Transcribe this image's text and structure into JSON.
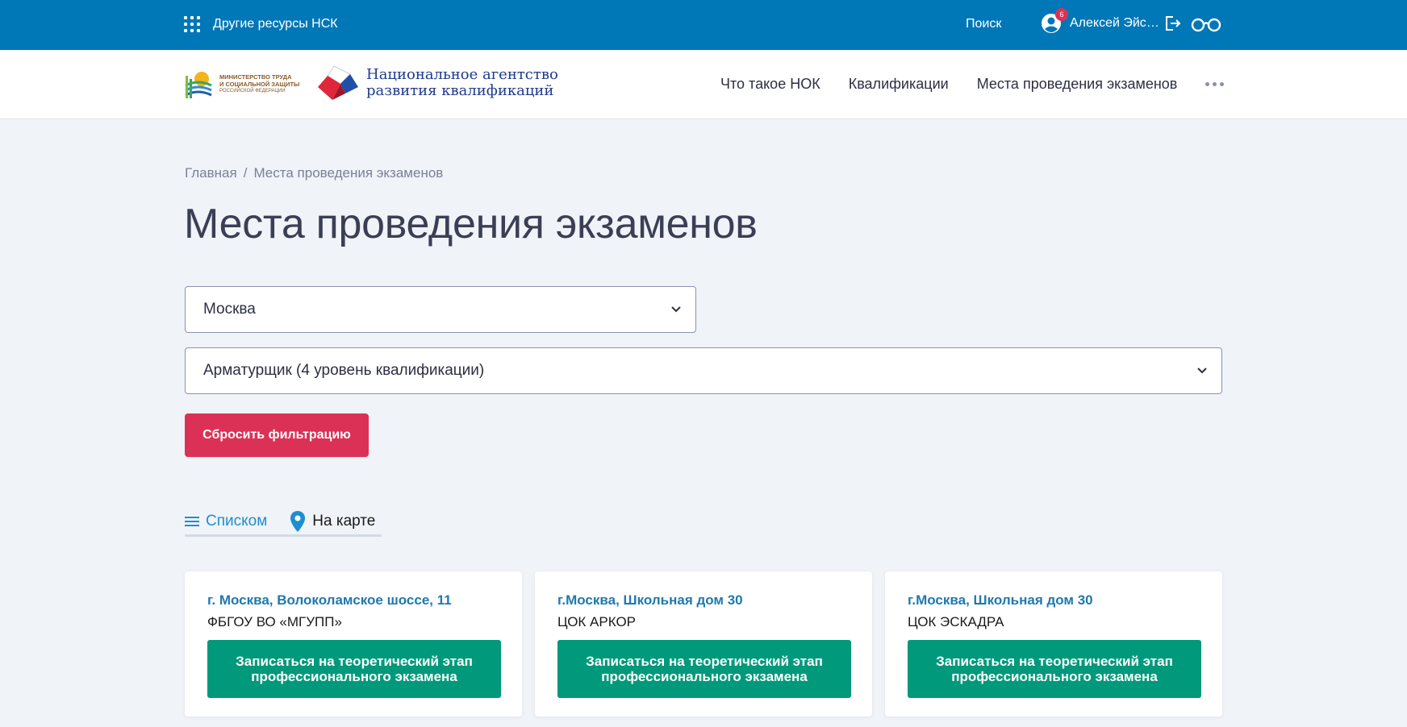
{
  "topbar": {
    "resources_label": "Другие ресурсы НСК",
    "search_label": "Поиск",
    "user_name": "Алексей Эйсмонт",
    "notifications_count": "6",
    "icons": [
      "apps-grid-icon",
      "user-avatar-icon",
      "logout-icon",
      "accessibility-glasses-icon"
    ],
    "color": "#0077b6"
  },
  "header": {
    "ministry_logo": {
      "line1": "МИНИСТЕРСТВО ТРУДА",
      "line2": "И СОЦИАЛЬНОЙ ЗАЩИТЫ",
      "line3": "РОССИЙСКОЙ ФЕДЕРАЦИИ"
    },
    "agency_logo": {
      "line1": "Национальное агентство",
      "line2": "развития квалификаций"
    },
    "nav": [
      "Что такое НОК",
      "Квалификации",
      "Места проведения экзаменов"
    ],
    "more_icon": "more-dots-icon"
  },
  "breadcrumb": {
    "home": "Главная",
    "separator": "/",
    "current": "Места проведения экзаменов"
  },
  "page_title": "Места проведения экзаменов",
  "filters": {
    "city_value": "Москва",
    "qualification_value": "Арматурщик (4 уровень квалификации)",
    "reset_label": "Сбросить фильтрацию"
  },
  "view_tabs": {
    "list_label": "Списком",
    "map_label": "На карте",
    "active": "list"
  },
  "centers": [
    {
      "address": "г. Москва, Волоколамское шоссе, 11",
      "name": "ФБГОУ ВО «МГУПП»",
      "button": "Записаться на теоретический этап профессионального экзамена"
    },
    {
      "address": "г.Москва, Школьная дом 30",
      "name": "ЦОК АРКОР",
      "button": "Записаться на теоретический этап профессионального экзамена"
    },
    {
      "address": "г.Москва, Школьная дом 30",
      "name": "ЦОК ЭСКАДРА",
      "button": "Записаться на теоретический этап профессионального экзамена"
    }
  ],
  "colors": {
    "primary_blue": "#0077b6",
    "accent_red": "#dc3157",
    "action_green": "#00997b",
    "link_blue": "#1f79ad",
    "background": "#f0f3f8"
  }
}
